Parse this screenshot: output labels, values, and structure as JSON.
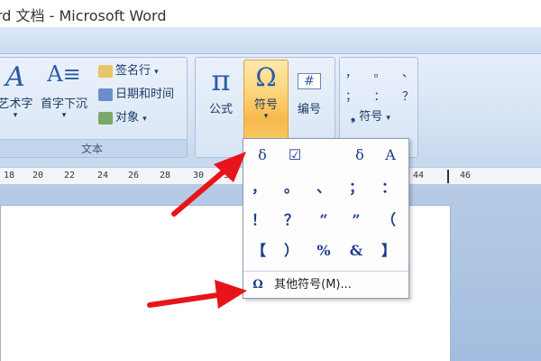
{
  "window": {
    "title": "rd 文档 - Microsoft Word"
  },
  "ribbon": {
    "text_group": {
      "label": "文本",
      "wordart_label": "艺术字",
      "dropcap_label": "首字下沉",
      "signature_label": "签名行",
      "datetime_label": "日期和时间",
      "object_label": "对象"
    },
    "symbols_group": {
      "equation_label": "公式",
      "symbol_label": "符号",
      "numbering_label": "编号"
    },
    "special_group": {
      "symbols_row1": [
        "，",
        "。",
        "、"
      ],
      "symbols_row2": [
        "；",
        "：",
        "？"
      ],
      "symbol_label": "符号"
    }
  },
  "ruler": {
    "ticks": [
      "18",
      "20",
      "22",
      "24",
      "26",
      "28",
      "30",
      "32",
      "44",
      "46"
    ]
  },
  "symbol_dropdown": {
    "row1": [
      "δ",
      "☑",
      "δ",
      "A"
    ],
    "row2": [
      "，",
      "。",
      "、",
      "；",
      "："
    ],
    "row3": [
      "！",
      "？",
      "“",
      "”",
      "（"
    ],
    "row4": [
      "【",
      "）",
      "%",
      "&",
      "】"
    ],
    "more_label": "其他符号(M)...",
    "more_icon": "Ω"
  },
  "colors": {
    "accent_orange": "#f7b84c",
    "arrow_red": "#e8141a",
    "ribbon_blue": "#d7e4f4"
  }
}
